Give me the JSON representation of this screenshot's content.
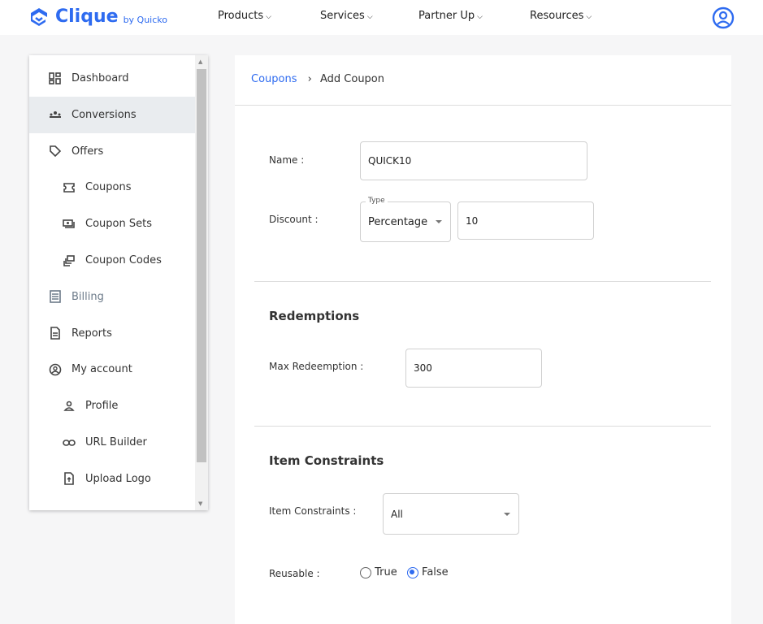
{
  "header": {
    "brand": "Clique",
    "by": "by Quicko",
    "nav": [
      "Products",
      "Services",
      "Partner Up",
      "Resources"
    ]
  },
  "sidebar": {
    "items": [
      {
        "label": "Dashboard",
        "icon": "dashboard-icon",
        "active": false
      },
      {
        "label": "Conversions",
        "icon": "groups-icon",
        "active": true
      },
      {
        "label": "Offers",
        "icon": "tag-icon",
        "active": false
      },
      {
        "label": "Coupons",
        "icon": "ticket-icon",
        "active": false
      },
      {
        "label": "Coupon Sets",
        "icon": "payments-icon",
        "active": false
      },
      {
        "label": "Coupon Codes",
        "icon": "stack-icon",
        "active": false
      },
      {
        "label": "Billing",
        "icon": "receipt-icon",
        "active": false
      },
      {
        "label": "Reports",
        "icon": "document-icon",
        "active": false
      },
      {
        "label": "My account",
        "icon": "account-circle-icon",
        "active": false
      },
      {
        "label": "Profile",
        "icon": "person-icon",
        "active": false
      },
      {
        "label": "URL Builder",
        "icon": "link-icon",
        "active": false
      },
      {
        "label": "Upload Logo",
        "icon": "upload-file-icon",
        "active": false
      }
    ]
  },
  "breadcrumb": {
    "parent": "Coupons",
    "current": "Add Coupon"
  },
  "form": {
    "name_label": "Name :",
    "name_value": "QUICK10",
    "discount_label": "Discount :",
    "type_label": "Type",
    "type_value": "Percentage",
    "discount_value": "10",
    "redemptions_heading": "Redemptions",
    "max_label": "Max Redeemption :",
    "max_value": "300",
    "constraints_heading": "Item Constraints",
    "constraints_label": "Item Constraints :",
    "constraints_value": "All",
    "reusable_label": "Reusable :",
    "reusable_options": [
      "True",
      "False"
    ],
    "reusable_selected": "False"
  },
  "colors": {
    "accent": "#2e6bf0"
  }
}
